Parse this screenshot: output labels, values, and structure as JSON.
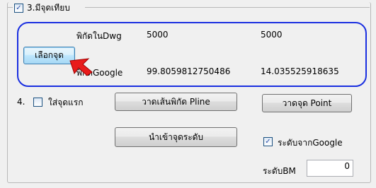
{
  "section3": {
    "checkbox_label": "3.มีจุดเทียบ",
    "checked": true
  },
  "coords": {
    "dwg_label": "พิกัดในDwg",
    "dwg_x": "5000",
    "dwg_y": "5000",
    "google_label": "พิกัดGoogle",
    "google_x": "99.8059812750486",
    "google_y": "14.035525918635"
  },
  "select_point_button": "เลือกจุด",
  "section4": {
    "number": "4.",
    "checkbox_label": "ใส่จุดแรก",
    "checked": false
  },
  "buttons": {
    "draw_pline": "วาดเส้นพิกัด Pline",
    "draw_point": "วาดจุด Point",
    "import_levels": "นำเข้าจุดระดับ"
  },
  "level_from_google": {
    "label": "ระดับจากGoogle",
    "checked": true
  },
  "bm_level": {
    "label": "ระดับBM",
    "value": "0"
  },
  "colors": {
    "highlight_border": "#1a2fe0",
    "pointer_arrow": "#e81b1b"
  },
  "icons": {
    "pointer": "red-arrow-icon"
  }
}
